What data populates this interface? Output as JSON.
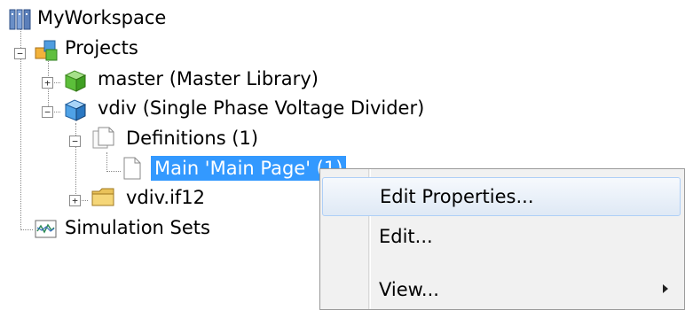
{
  "tree": {
    "workspace": {
      "label": "MyWorkspace"
    },
    "projects": {
      "label": "Projects"
    },
    "master": {
      "label": "master (Master Library)"
    },
    "vdiv": {
      "label": "vdiv (Single Phase Voltage Divider)"
    },
    "definitions": {
      "label": "Definitions (1)"
    },
    "main": {
      "label": "Main 'Main Page' (1)"
    },
    "vdiv_if12": {
      "label": "vdiv.if12"
    },
    "simulation_sets": {
      "label": "Simulation Sets"
    }
  },
  "context_menu": {
    "items": [
      {
        "label": "Edit Properties...",
        "hovered": true
      },
      {
        "label": "Edit...",
        "hovered": false
      },
      {
        "label": "View...",
        "submenu": true
      }
    ]
  },
  "colors": {
    "selection": "#3399ff",
    "menu_background": "#f1f1f1",
    "hover_border": "#aecff7"
  },
  "icons": {
    "workspace": "workspace-icon",
    "projects": "projects-icon",
    "master": "library-cube-icon",
    "vdiv": "project-cube-icon",
    "definitions": "document-stack-icon",
    "main": "page-icon",
    "vdiv_if12": "folder-icon",
    "simulation_sets": "waveform-icon"
  }
}
